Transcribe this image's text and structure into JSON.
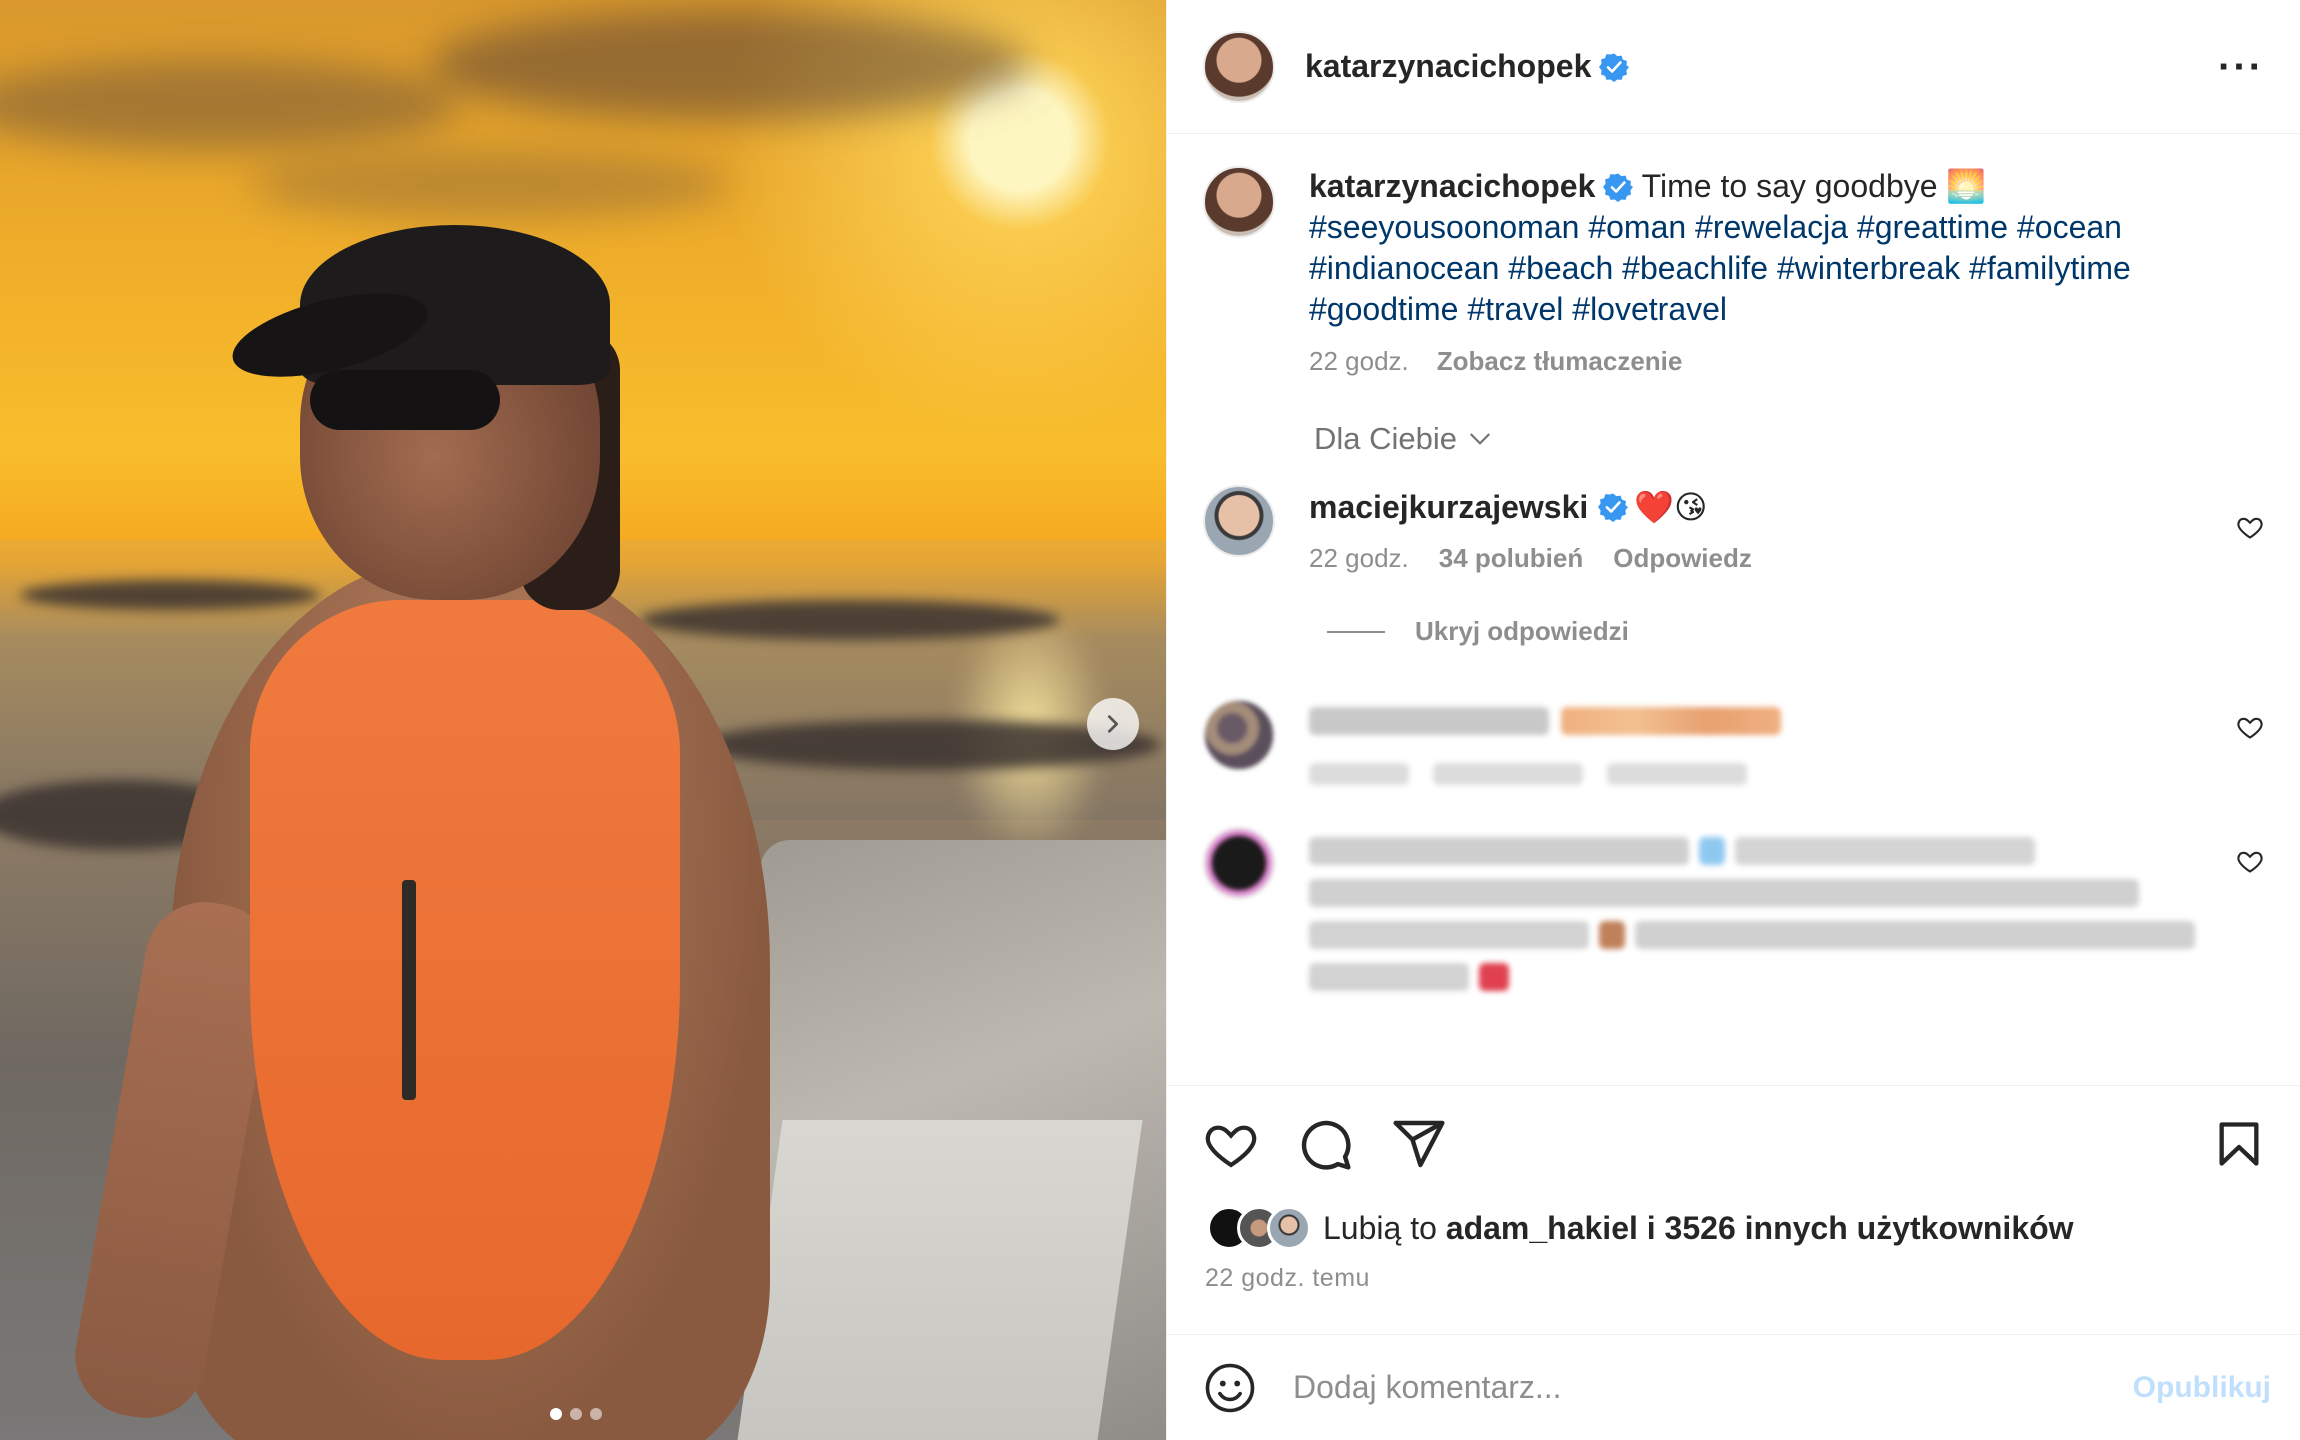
{
  "post": {
    "username": "katarzynacichopek",
    "verified": true,
    "caption_text": "Time to say goodbye",
    "caption_emoji": "🌅",
    "hashtags_line1": "#seeyousoonoman #oman #rewelacja #greattime #ocean",
    "hashtags_line2": "#indianocean #beach #beachlife #winterbreak #familytime",
    "hashtags_line3": "#goodtime #travel #lovetravel",
    "time": "22 godz.",
    "translate_label": "Zobacz tłumaczenie"
  },
  "filter": {
    "label": "Dla Ciebie"
  },
  "comments": [
    {
      "username": "maciejkurzajewski",
      "verified": true,
      "emoji": "❤️😘",
      "time": "22 godz.",
      "likes": "34 polubień",
      "reply_label": "Odpowiedz"
    }
  ],
  "hide_replies_label": "Ukryj odpowiedzi",
  "likes_summary": {
    "prefix": "Lubią to",
    "user": "adam_hakiel",
    "suffix": "i 3526 innych użytkowników"
  },
  "time_ago": "22 godz. temu",
  "comment_input": {
    "placeholder": "Dodaj komentarz...",
    "value": ""
  },
  "publish_label": "Opublikuj",
  "carousel": {
    "current": 1,
    "total": 3
  },
  "colors": {
    "accent_link": "#00376b",
    "verified_blue": "#3897f0",
    "publish_disabled": "#c0dffd",
    "muted": "#8e8e8e"
  },
  "icons": [
    "more-icon",
    "verified-icon",
    "chevron-down-icon",
    "heart-icon",
    "comment-icon",
    "share-icon",
    "bookmark-icon",
    "emoji-icon",
    "next-arrow-icon"
  ]
}
